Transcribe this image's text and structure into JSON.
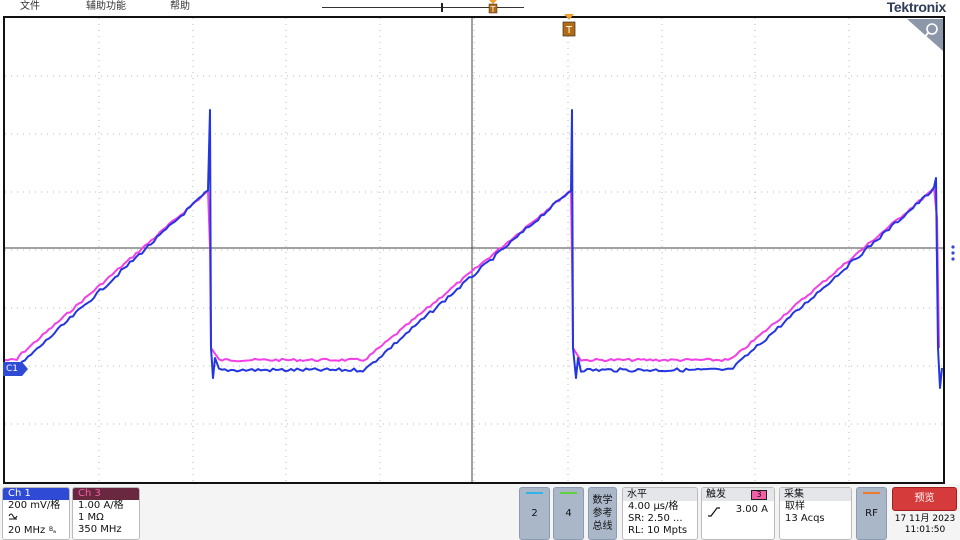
{
  "menu": {
    "file": "文件",
    "utility": "辅助功能",
    "help": "帮助"
  },
  "brand": "Tektronix",
  "markers": {
    "trigger_pos": "T",
    "channel1": "C1"
  },
  "colors": {
    "ch1": "#2336e0",
    "ch3": "#f23fe6",
    "trigger_marker": "#f0a030",
    "preview": "#d63b3b"
  },
  "ch1": {
    "name": "Ch 1",
    "scale": "200 mV/格",
    "bandwidth": "20 MHz",
    "coupling_icon": "ac-coupling-icon",
    "bw_icon": "bandwidth-limit-icon"
  },
  "ch3": {
    "name": "Ch 3",
    "scale": "1.00 A/格",
    "impedance": "1 MΩ",
    "bandwidth": "350 MHz"
  },
  "channel_buttons": {
    "ch2": "2",
    "ch4": "4"
  },
  "math_ref_bus": {
    "line1": "数学",
    "line2": "参考",
    "line3": "总线"
  },
  "horizontal": {
    "title": "水平",
    "scale": "4.00 μs/格",
    "sample_rate": "SR: 2.50 ...",
    "record_length": "RL: 10 Mpts"
  },
  "trigger": {
    "title": "触发",
    "source": "3",
    "slope_icon": "rising-edge-icon",
    "level": "3.00 A"
  },
  "acquisition": {
    "title": "采集",
    "mode": "取样",
    "count": "13 Acqs"
  },
  "rf_button": "RF",
  "preview_button": "预览",
  "datetime": {
    "date": "17 11月 2023",
    "time": "11:01:50"
  }
}
